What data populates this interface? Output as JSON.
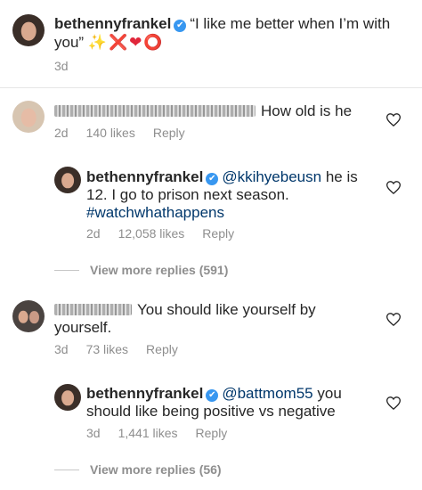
{
  "caption": {
    "username": "bethennyfrankel",
    "text": "“I like me better when I’m with you”",
    "emojis": "✨❌❤️⭕",
    "time": "3d"
  },
  "comments": [
    {
      "username": "both_whitetrash_quite_frankly",
      "text": "How old is he",
      "time": "2d",
      "likes": "140 likes",
      "reply": "Reply",
      "replies": [
        {
          "username": "bethennyfrankel",
          "mention": "@kkihyebeusn",
          "text_line1_rest": "he is",
          "text_line2": "12. I go to prison next season.",
          "hashtag": "#watchwhathappens",
          "time": "2d",
          "likes": "12,058 likes",
          "reply": "Reply"
        }
      ],
      "view_more": "View more replies (591)"
    },
    {
      "username": "battmom55",
      "text_line1": "You should like yourself by",
      "text_line2": "yourself.",
      "time": "3d",
      "likes": "73 likes",
      "reply": "Reply",
      "replies": [
        {
          "username": "bethennyfrankel",
          "mention": "@battmom55",
          "text_line1_rest": "you",
          "text_line2": "should like being positive vs negative",
          "time": "3d",
          "likes": "1,441 likes",
          "reply": "Reply"
        }
      ],
      "view_more": "View more replies (56)"
    }
  ],
  "icons": {
    "verified": "✔",
    "like": "heart-icon"
  }
}
